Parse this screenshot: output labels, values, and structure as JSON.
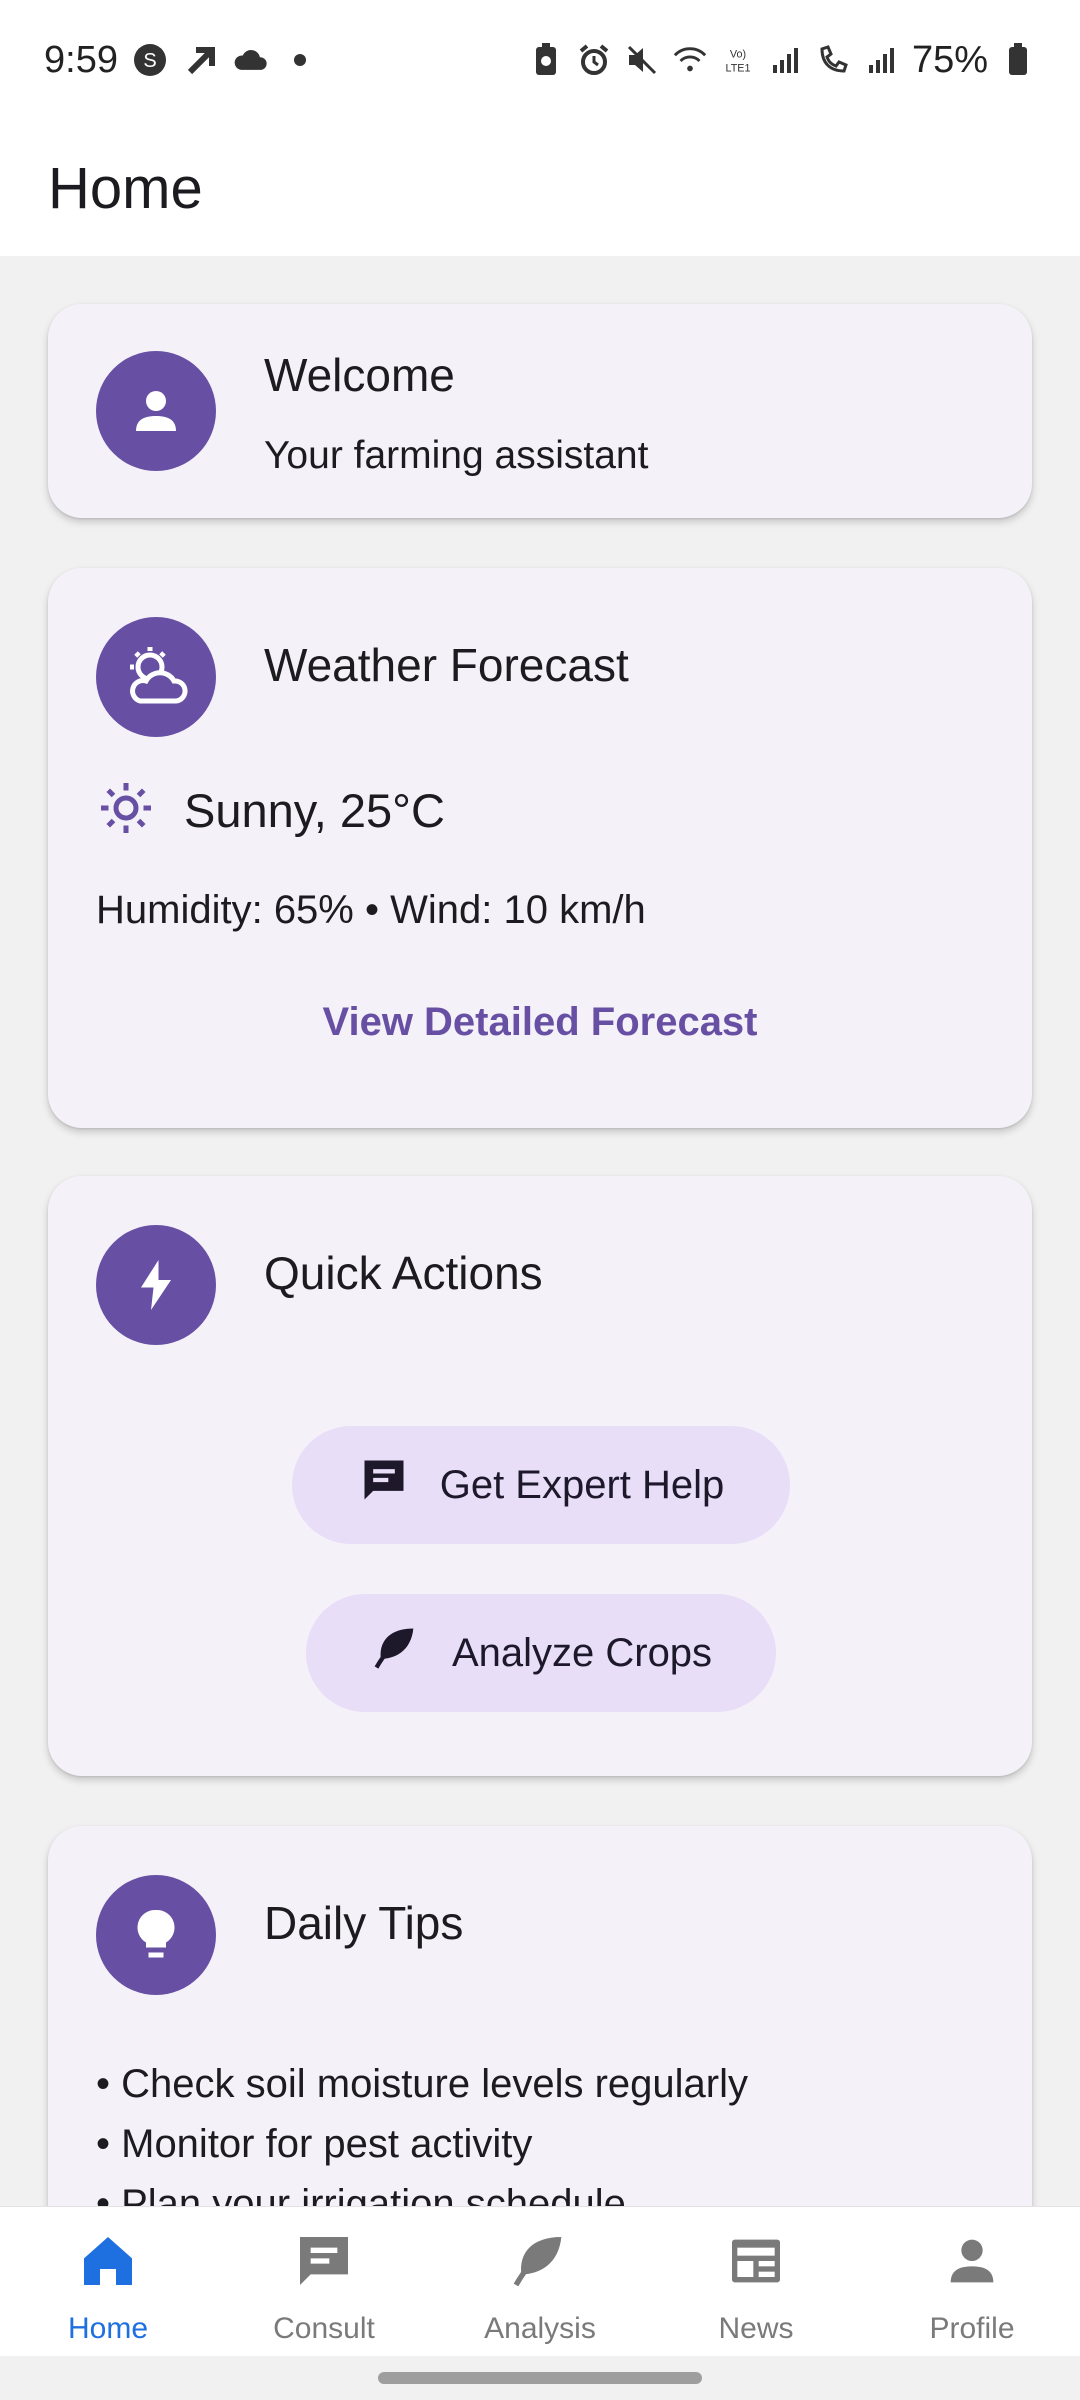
{
  "status_bar": {
    "time": "9:59",
    "battery": "75%",
    "left_icons": [
      "s-circle-icon",
      "arrow-up-right-icon",
      "cloud-icon",
      "dot-icon"
    ],
    "right_icons": [
      "battery-saver-icon",
      "alarm-icon",
      "mute-icon",
      "wifi-icon",
      "volte-icon",
      "signal-icon",
      "wifi-calling-icon",
      "signal-icon",
      "battery-icon"
    ]
  },
  "app_bar": {
    "title": "Home"
  },
  "welcome": {
    "icon": "person-icon",
    "title": "Welcome",
    "subtitle": "Your farming assistant"
  },
  "weather": {
    "icon": "partly-cloudy-icon",
    "title": "Weather Forecast",
    "condition_icon": "sun-icon",
    "condition": "Sunny, 25°C",
    "details": "Humidity: 65% • Wind: 10 km/h",
    "link_label": "View Detailed Forecast"
  },
  "quick_actions": {
    "icon": "bolt-icon",
    "title": "Quick Actions",
    "buttons": [
      {
        "label": "Get Expert Help",
        "icon": "chat-icon"
      },
      {
        "label": "Analyze Crops",
        "icon": "leaf-icon"
      }
    ]
  },
  "daily_tips": {
    "icon": "lightbulb-icon",
    "title": "Daily Tips",
    "tips": [
      "• Check soil moisture levels regularly",
      "• Monitor for pest activity",
      "• Plan your irrigation schedule"
    ]
  },
  "bottom_nav": {
    "items": [
      {
        "label": "Home",
        "icon": "home-icon",
        "active": true
      },
      {
        "label": "Consult",
        "icon": "chat-icon",
        "active": false
      },
      {
        "label": "Analysis",
        "icon": "leaf-icon",
        "active": false
      },
      {
        "label": "News",
        "icon": "newspaper-icon",
        "active": false
      },
      {
        "label": "Profile",
        "icon": "person-icon",
        "active": false
      }
    ]
  },
  "colors": {
    "primary": "#6750a4",
    "card_background": "#f5f1f9",
    "pill_background": "#e8def8",
    "nav_active": "#1e6fe0",
    "nav_inactive": "#7a7a7a"
  }
}
